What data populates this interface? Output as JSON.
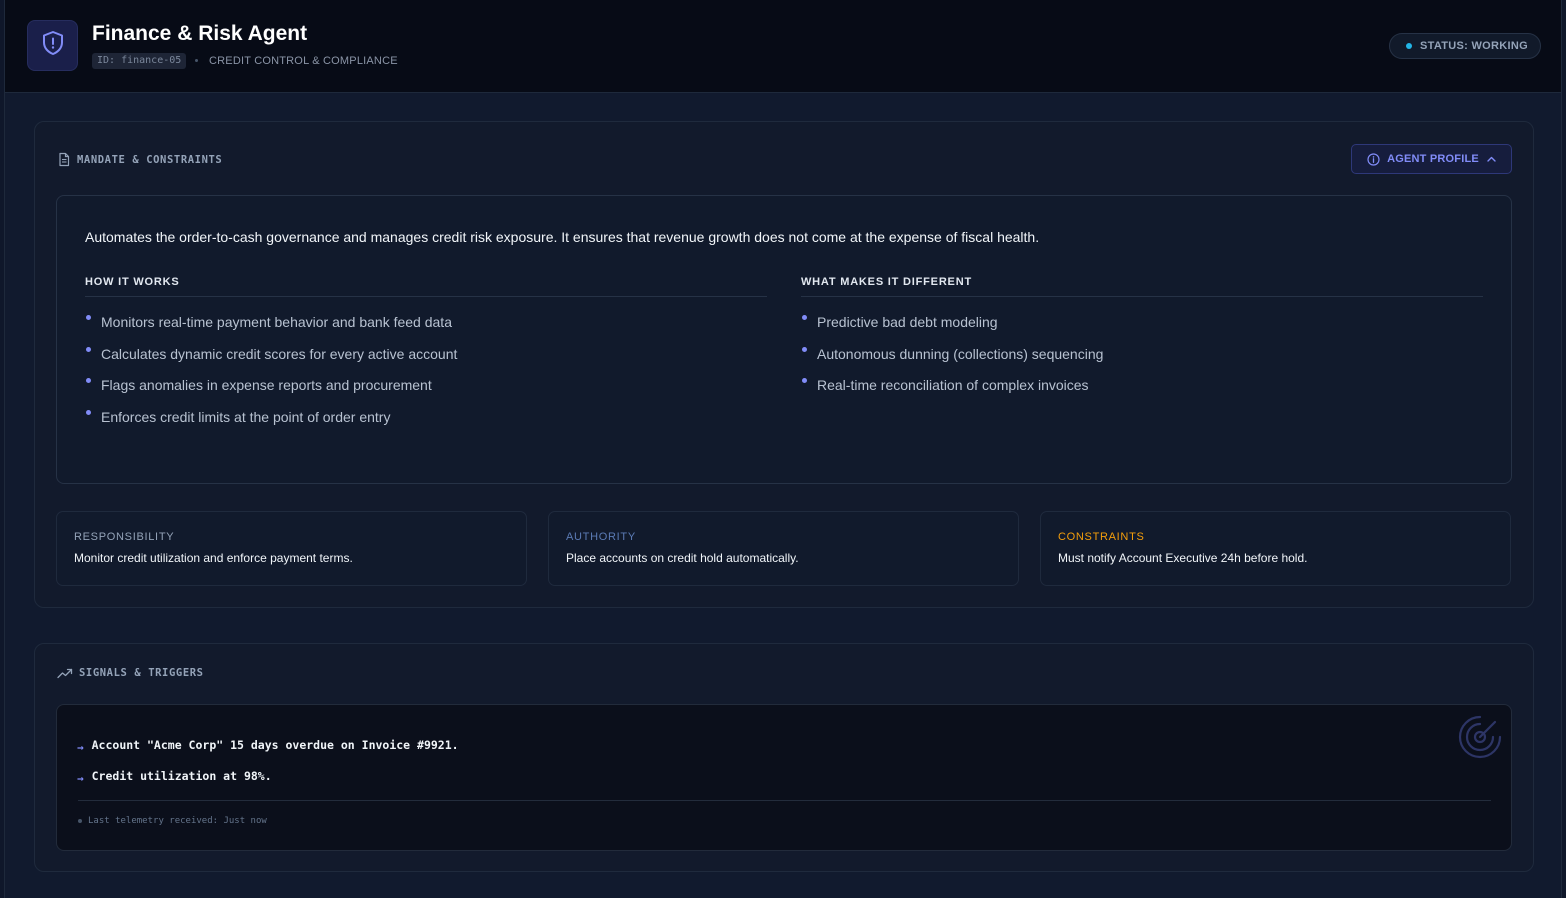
{
  "header": {
    "title": "Finance & Risk Agent",
    "id": "ID: finance-05",
    "subtitle": "CREDIT CONTROL & COMPLIANCE",
    "status": "STATUS: WORKING",
    "logo_icon": "shield-alert-icon"
  },
  "mandate": {
    "heading": "MANDATE & CONSTRAINTS",
    "profile_button": "AGENT PROFILE",
    "summary": "Automates the order-to-cash governance and manages credit risk exposure. It ensures that revenue growth does not come at the expense of fiscal health.",
    "how": {
      "title": "HOW IT WORKS",
      "items": [
        "Monitors real-time payment behavior and bank feed data",
        "Calculates dynamic credit scores for every active account",
        "Flags anomalies in expense reports and procurement",
        "Enforces credit limits at the point of order entry"
      ]
    },
    "different": {
      "title": "WHAT MAKES IT DIFFERENT",
      "items": [
        "Predictive bad debt modeling",
        "Autonomous dunning (collections) sequencing",
        "Real-time reconciliation of complex invoices"
      ]
    },
    "cards": [
      {
        "label": "RESPONSIBILITY",
        "text": "Monitor credit utilization and enforce payment terms.",
        "color": "#94a3b8"
      },
      {
        "label": "AUTHORITY",
        "text": "Place accounts on credit hold automatically.",
        "color": "#5b7bb5"
      },
      {
        "label": "CONSTRAINTS",
        "text": "Must notify Account Executive 24h before hold.",
        "color": "#f59e0b"
      }
    ]
  },
  "signals": {
    "heading": "SIGNALS & TRIGGERS",
    "items": [
      "Account \"Acme Corp\" 15 days overdue on Invoice #9921.",
      "Credit utilization at 98%."
    ],
    "telemetry": "Last telemetry received: Just now"
  },
  "colors": {
    "accent": "#818cf8",
    "status_dot": "#22b5e6",
    "warning": "#f59e0b"
  }
}
